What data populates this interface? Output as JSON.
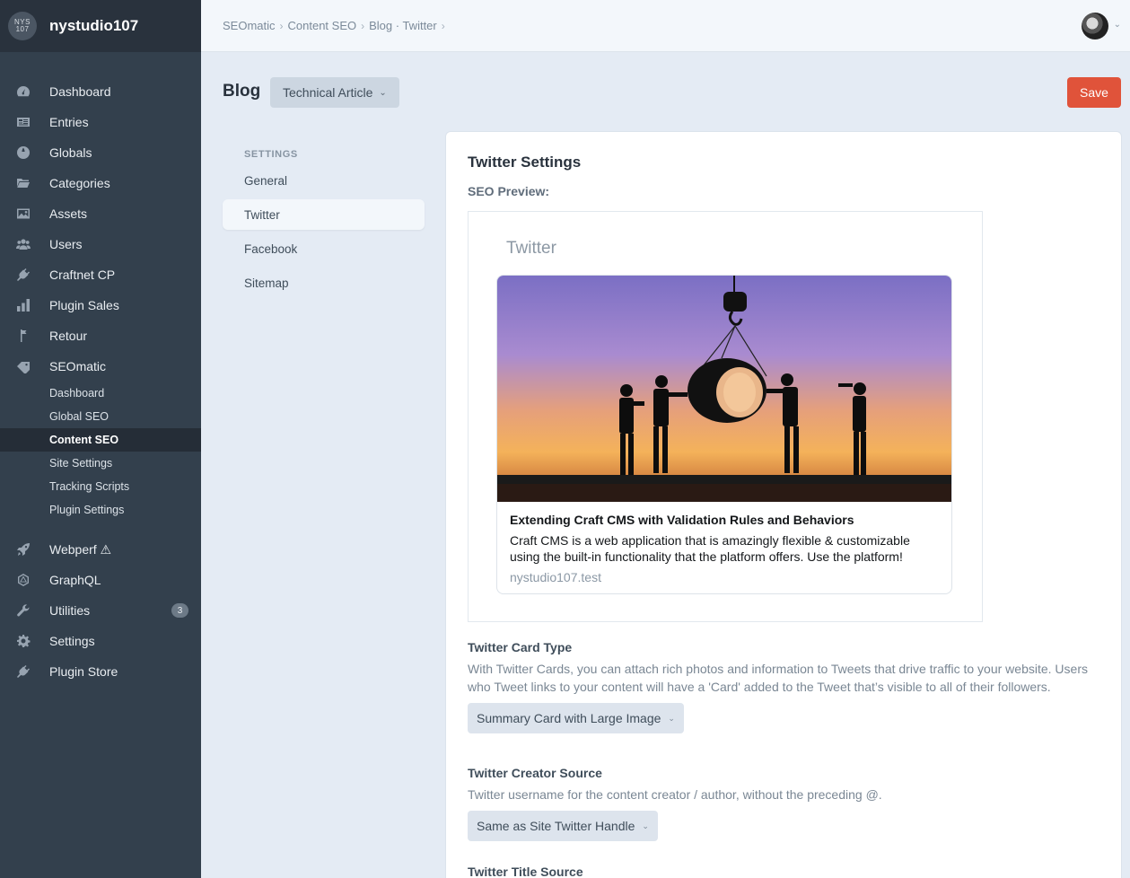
{
  "sidebar": {
    "site_logo_text": "NYS 107",
    "site_name": "nystudio107",
    "nav": [
      {
        "label": "Dashboard",
        "icon": "gauge-icon"
      },
      {
        "label": "Entries",
        "icon": "newspaper-icon"
      },
      {
        "label": "Globals",
        "icon": "globe-icon"
      },
      {
        "label": "Categories",
        "icon": "folder-icon"
      },
      {
        "label": "Assets",
        "icon": "image-icon"
      },
      {
        "label": "Users",
        "icon": "users-icon"
      },
      {
        "label": "Craftnet CP",
        "icon": "plug-icon"
      },
      {
        "label": "Plugin Sales",
        "icon": "bar-chart-icon"
      },
      {
        "label": "Retour",
        "icon": "signpost-icon"
      },
      {
        "label": "SEOmatic",
        "icon": "tag-icon"
      }
    ],
    "seomatic_subnav": [
      {
        "label": "Dashboard"
      },
      {
        "label": "Global SEO"
      },
      {
        "label": "Content SEO"
      },
      {
        "label": "Site Settings"
      },
      {
        "label": "Tracking Scripts"
      },
      {
        "label": "Plugin Settings"
      }
    ],
    "nav_bottom": [
      {
        "label": "Webperf ⚠",
        "icon": "rocket-icon"
      },
      {
        "label": "GraphQL",
        "icon": "graphql-icon"
      },
      {
        "label": "Utilities",
        "icon": "wrench-icon",
        "badge": "3"
      },
      {
        "label": "Settings",
        "icon": "gear-icon"
      },
      {
        "label": "Plugin Store",
        "icon": "plug-icon"
      }
    ]
  },
  "breadcrumbs": [
    "SEOmatic",
    "Content SEO",
    "Blog · Twitter"
  ],
  "page": {
    "title": "Blog",
    "entry_type": "Technical Article",
    "save_label": "Save"
  },
  "settings_nav": {
    "heading": "SETTINGS",
    "items": [
      "General",
      "Twitter",
      "Facebook",
      "Sitemap"
    ],
    "selected": "Twitter"
  },
  "panel": {
    "title": "Twitter Settings",
    "preview_label": "SEO Preview:",
    "preview_platform": "Twitter",
    "card": {
      "image": "silhouettes-lifting-pipe-sunset-image",
      "title": "Extending Craft CMS with Validation Rules and Behaviors",
      "description": "Craft CMS is a web application that is amazingly flexible & customizable using the built-in functionality that the platform offers. Use the platform!",
      "domain": "nystudio107.test"
    },
    "fields": [
      {
        "label": "Twitter Card Type",
        "help": "With Twitter Cards, you can attach rich photos and information to Tweets that drive traffic to your website. Users who Tweet links to your content will have a 'Card' added to the Tweet that’s visible to all of their followers.",
        "value": "Summary Card with Large Image"
      },
      {
        "label": "Twitter Creator Source",
        "help": "Twitter username for the content creator / author, without the preceding @.",
        "value": "Same as Site Twitter Handle"
      },
      {
        "label": "Twitter Title Source"
      }
    ]
  }
}
